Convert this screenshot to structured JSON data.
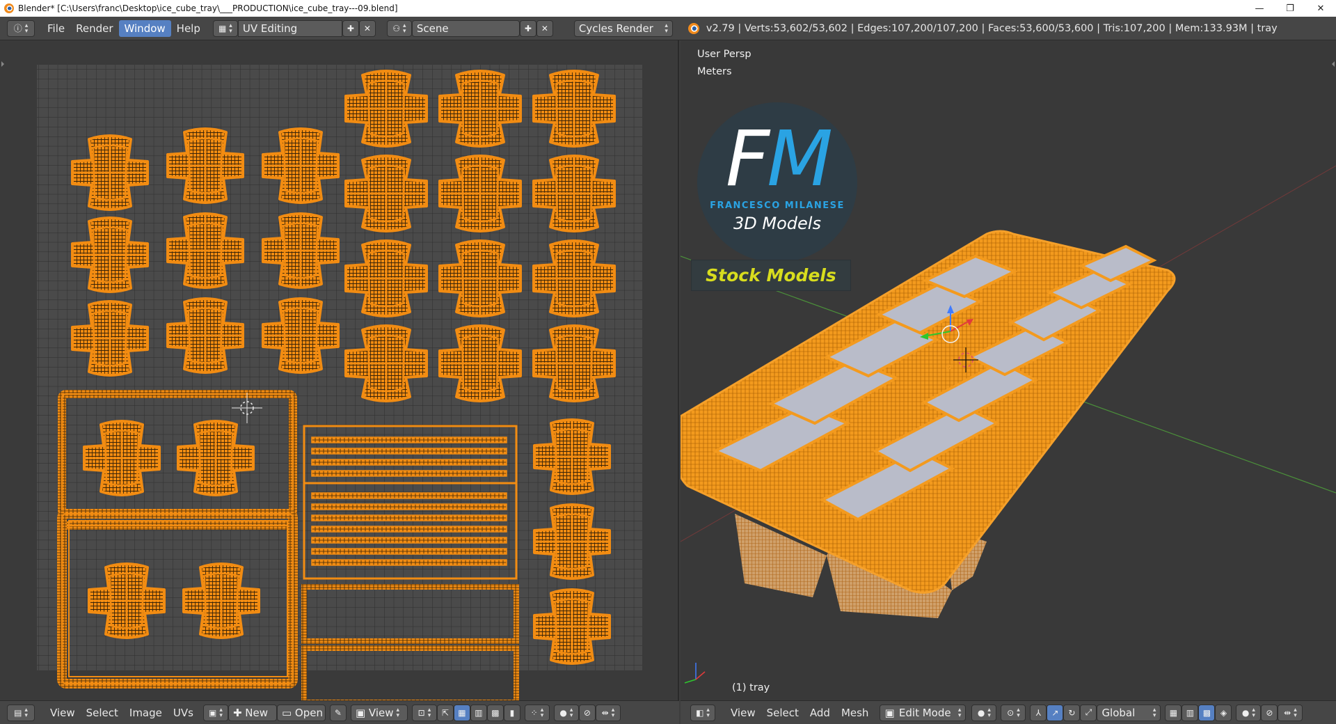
{
  "window": {
    "title": "Blender* [C:\\Users\\franc\\Desktop\\ice_cube_tray\\___PRODUCTION\\ice_cube_tray---09.blend]",
    "controls": [
      "—",
      "❐",
      "✕"
    ]
  },
  "topbar": {
    "menus": [
      "File",
      "Render",
      "Window",
      "Help"
    ],
    "active_menu": "Window",
    "layout": "UV Editing",
    "scene": "Scene",
    "engine": "Cycles Render",
    "stats": "v2.79 | Verts:53,602/53,602 | Edges:107,200/107,200 | Faces:53,600/53,600 | Tris:107,200 | Mem:133.93M | tray"
  },
  "viewport": {
    "perspective": "User Persp",
    "units": "Meters",
    "object_label": "(1) tray",
    "logo": {
      "initial_1": "F",
      "initial_2": "M",
      "name": "FRANCESCO MILANESE",
      "subtitle": "3D Models",
      "badge": "Stock Models"
    }
  },
  "uv_header": {
    "menus": [
      "View",
      "Select",
      "Image",
      "UVs"
    ],
    "new_label": "New",
    "open_label": "Open",
    "view_label": "View"
  },
  "view3d_header": {
    "menus": [
      "View",
      "Select",
      "Add",
      "Mesh"
    ],
    "mode": "Edit Mode",
    "orientation": "Global"
  },
  "colors": {
    "uv_orange": "#f28c12",
    "active_menu": "#5680c2",
    "logo_blue": "#2aa3e3",
    "badge_yellow": "#d8dd1e"
  }
}
